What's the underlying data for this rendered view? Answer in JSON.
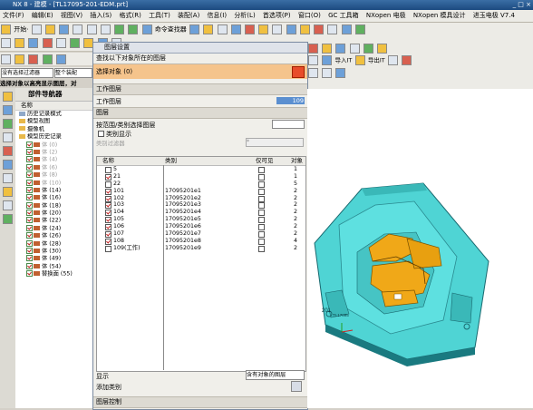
{
  "title": "NX 8 - 建模 - [TL17095-201-EDM.prt]",
  "menu": [
    "文件(F)",
    "编辑(E)",
    "视图(V)",
    "插入(S)",
    "格式(R)",
    "工具(T)",
    "装配(A)",
    "信息(I)",
    "分析(L)",
    "首选项(P)",
    "窗口(O)",
    "GC 工具箱",
    "NXopen 电极",
    "NXopen 模具设计",
    "进玉电极 V7.4"
  ],
  "toolbar": {
    "start_label": "开始·",
    "cmd_finder": "命令查找器",
    "import_label": "导入IT",
    "export_label": "导出IT"
  },
  "filter": {
    "selection_filter": "没有选择过滤器",
    "whole_assembly": "整个装配"
  },
  "status_prompt": "选择对象以高亮显示图层，对",
  "nav": {
    "title": "部件导航器",
    "col_name": "名称",
    "items": [
      {
        "label": "历史记录模式",
        "indent": 1,
        "type": "plain",
        "gray": false,
        "checked": false
      },
      {
        "label": "模型视图",
        "indent": 1,
        "type": "folder",
        "gray": false,
        "checked": false
      },
      {
        "label": "摄像机",
        "indent": 1,
        "type": "folder",
        "gray": false,
        "checked": false
      },
      {
        "label": "模型历史记录",
        "indent": 1,
        "type": "folder",
        "gray": false,
        "checked": false
      },
      {
        "label": "体 (0)",
        "indent": 2,
        "type": "body",
        "gray": true,
        "checked": true
      },
      {
        "label": "体 (2)",
        "indent": 2,
        "type": "body",
        "gray": true,
        "checked": true
      },
      {
        "label": "体 (4)",
        "indent": 2,
        "type": "body",
        "gray": true,
        "checked": true
      },
      {
        "label": "体 (6)",
        "indent": 2,
        "type": "body",
        "gray": true,
        "checked": true
      },
      {
        "label": "体 (8)",
        "indent": 2,
        "type": "body",
        "gray": true,
        "checked": true
      },
      {
        "label": "体 (10)",
        "indent": 2,
        "type": "body",
        "gray": true,
        "checked": true
      },
      {
        "label": "体 (14)",
        "indent": 2,
        "type": "body",
        "gray": false,
        "checked": true
      },
      {
        "label": "体 (16)",
        "indent": 2,
        "type": "body",
        "gray": false,
        "checked": true
      },
      {
        "label": "体 (18)",
        "indent": 2,
        "type": "body",
        "gray": false,
        "checked": true
      },
      {
        "label": "体 (20)",
        "indent": 2,
        "type": "body",
        "gray": false,
        "checked": true
      },
      {
        "label": "体 (22)",
        "indent": 2,
        "type": "body",
        "gray": false,
        "checked": true
      },
      {
        "label": "体 (24)",
        "indent": 2,
        "type": "body",
        "gray": false,
        "checked": true
      },
      {
        "label": "体 (26)",
        "indent": 2,
        "type": "body",
        "gray": false,
        "checked": true
      },
      {
        "label": "体 (28)",
        "indent": 2,
        "type": "body",
        "gray": false,
        "checked": true
      },
      {
        "label": "体 (30)",
        "indent": 2,
        "type": "body",
        "gray": false,
        "checked": true
      },
      {
        "label": "体 (49)",
        "indent": 2,
        "type": "body",
        "gray": false,
        "checked": true
      },
      {
        "label": "体 (54)",
        "indent": 2,
        "type": "body",
        "gray": false,
        "checked": true
      },
      {
        "label": "替换面 (55)",
        "indent": 2,
        "type": "body",
        "gray": false,
        "checked": true
      }
    ]
  },
  "dialog": {
    "title": "图层设置",
    "find_section": "查找以下对象所在的图层",
    "select_object": "选择对象 (0)",
    "work_layer_section": "工作图层",
    "work_layer_label": "工作图层",
    "work_layer_value": "109",
    "layer_section": "图层",
    "search_label": "按范围/类别选择图层",
    "category_display": "类别显示",
    "category_filter_label": "类别过滤器",
    "category_filter_value": "*",
    "columns": [
      "名称",
      "类别",
      "仅可见",
      "对象"
    ],
    "rows": [
      {
        "name": "5",
        "category": "",
        "vis": false,
        "obj": "1",
        "checked": false
      },
      {
        "name": "21",
        "category": "",
        "vis": false,
        "obj": "1",
        "checked": true
      },
      {
        "name": "22",
        "category": "",
        "vis": false,
        "obj": "5",
        "checked": false
      },
      {
        "name": "101",
        "category": "17095201e1",
        "vis": false,
        "obj": "2",
        "checked": true
      },
      {
        "name": "102",
        "category": "17095201e2",
        "vis": false,
        "obj": "2",
        "checked": true
      },
      {
        "name": "103",
        "category": "17095201e3",
        "vis": false,
        "obj": "2",
        "checked": true
      },
      {
        "name": "104",
        "category": "17095201e4",
        "vis": false,
        "obj": "2",
        "checked": true
      },
      {
        "name": "105",
        "category": "17095201e5",
        "vis": false,
        "obj": "2",
        "checked": true
      },
      {
        "name": "106",
        "category": "17095201e6",
        "vis": false,
        "obj": "2",
        "checked": true
      },
      {
        "name": "107",
        "category": "17095201e7",
        "vis": false,
        "obj": "2",
        "checked": true
      },
      {
        "name": "108",
        "category": "17095201e8",
        "vis": false,
        "obj": "4",
        "checked": true
      },
      {
        "name": "109(工作)",
        "category": "17095201e9",
        "vis": false,
        "obj": "2",
        "checked": false
      }
    ],
    "show_label": "显示",
    "show_value": "含有对象的图层",
    "add_category": "添加类别",
    "layer_control": "图层控制"
  },
  "viewport": {
    "label_201": "201",
    "label_tl": "TL17095",
    "colors": {
      "base": "#4fd4d4",
      "part": "#f0a818",
      "dark": "#1a6a70"
    }
  }
}
